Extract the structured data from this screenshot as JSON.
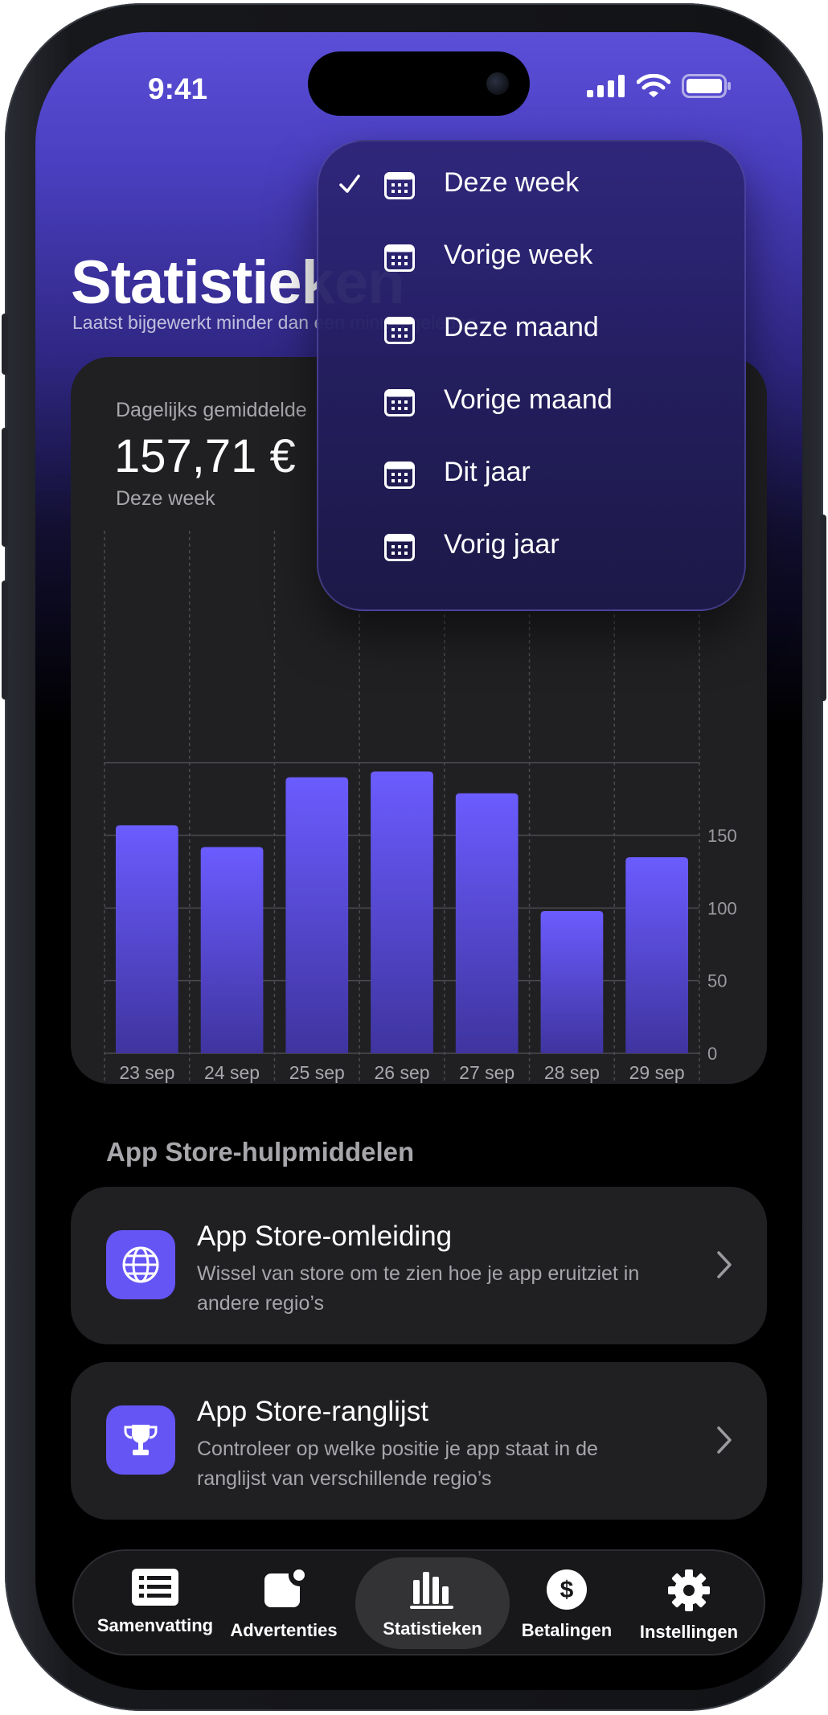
{
  "status_bar": {
    "time": "9:41"
  },
  "header": {
    "title": "Statistieken",
    "subtitle": "Laatst bijgewerkt minder dan een minuut geleden"
  },
  "summary": {
    "caption": "Dagelijks gemiddelde",
    "value": "157,71 €",
    "period": "Deze week"
  },
  "chart_data": {
    "type": "bar",
    "categories": [
      "23 sep",
      "24 sep",
      "25 sep",
      "26 sep",
      "27 sep",
      "28 sep",
      "29 sep"
    ],
    "values": [
      157,
      142,
      190,
      194,
      179,
      98,
      135
    ],
    "ylim": [
      0,
      200
    ],
    "yticks": [
      "0",
      "50",
      "100",
      "150"
    ],
    "colors": {
      "bar_top": "#6b5cff",
      "bar_bottom": "#3f349f",
      "grid": "#4a4a50"
    }
  },
  "tools": {
    "section_title": "App Store-hulpmiddelen",
    "items": [
      {
        "title": "App Store-omleiding",
        "description": "Wissel van store om te zien hoe je app eruitziet in andere regio’s",
        "icon": "globe-icon"
      },
      {
        "title": "App Store-ranglijst",
        "description": "Controleer op welke positie je app staat in de ranglijst van verschillende regio’s",
        "icon": "trophy-icon"
      }
    ]
  },
  "period_menu": {
    "selected": "Deze week",
    "items": [
      "Deze week",
      "Vorige week",
      "Deze maand",
      "Vorige maand",
      "Dit jaar",
      "Vorig jaar"
    ]
  },
  "tab_bar": {
    "active": "Statistieken",
    "items": [
      {
        "label": "Samenvatting",
        "icon": "list-icon"
      },
      {
        "label": "Advertenties",
        "icon": "ads-icon"
      },
      {
        "label": "Statistieken",
        "icon": "chart-icon"
      },
      {
        "label": "Betalingen",
        "icon": "dollar-icon"
      },
      {
        "label": "Instellingen",
        "icon": "gear-icon"
      }
    ]
  },
  "theme": {
    "accent": "#6555f5",
    "card": "#202023"
  }
}
